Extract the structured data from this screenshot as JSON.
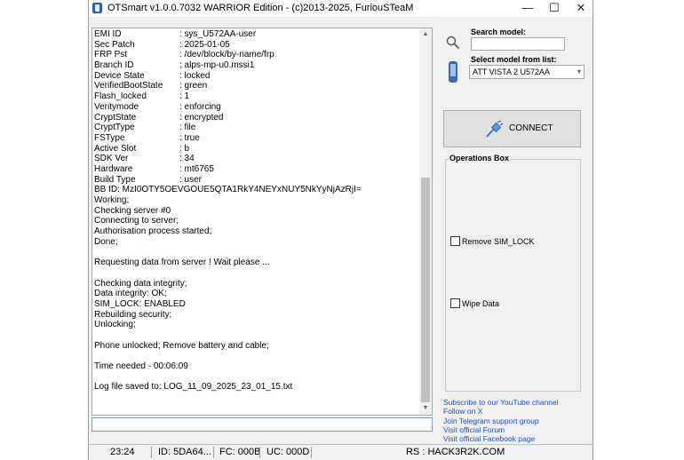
{
  "window": {
    "title": "OTSmart  v1.0.0.7032 WARRIOR Edition - (c)2013-2025, FuriouSTeaM",
    "minimize": "—",
    "maximize": "☐",
    "close": "✕"
  },
  "log": {
    "kv": [
      {
        "key": "EMI ID",
        "value": ": sys_U572AA-user"
      },
      {
        "key": "Sec Patch",
        "value": ": 2025-01-05"
      },
      {
        "key": "FRP Pst",
        "value": ": /dev/block/by-name/frp"
      },
      {
        "key": "Branch ID",
        "value": ": alps-mp-u0.mssi1"
      },
      {
        "key": "Device State",
        "value": ": locked"
      },
      {
        "key": "VerifiedBootState",
        "value": ": green"
      },
      {
        "key": "Flash_locked",
        "value": ": 1"
      },
      {
        "key": "Veritymode",
        "value": ": enforcing"
      },
      {
        "key": "CryptState",
        "value": ": encrypted"
      },
      {
        "key": "CryptType",
        "value": ": file"
      },
      {
        "key": "FSType",
        "value": ": true"
      },
      {
        "key": "Active Slot",
        "value": ": b"
      },
      {
        "key": "SDK Ver",
        "value": ": 34"
      },
      {
        "key": "Hardware",
        "value": ": mt6765"
      },
      {
        "key": "Build Type",
        "value": ": user"
      }
    ],
    "lines": [
      "BB ID: MzI0OTY5OEVGOUE5QTA1RkY4NEYxNUY5NkYyNjAzRjI=",
      "Working;",
      "Checking server #0",
      "Connecting to server;",
      "Authorisation process started;",
      "Done;",
      "",
      "Requesting data from server ! Wait please ...",
      "",
      "Checking data integrity;",
      "Data integrity: OK;",
      "SIM_LOCK: ENABLED",
      "Rebuilding security;",
      "Unlocking;",
      "",
      "Phone unlocked; Remove battery and cable;",
      "",
      "Time needed - 00:06:09",
      "",
      "Log file saved to: LOG_11_09_2025_23_01_15.txt"
    ],
    "command_value": ""
  },
  "search": {
    "label": "Search model:",
    "value": ""
  },
  "model": {
    "label": "Select model from list:",
    "selected": "ATT VISTA 2 U572AA"
  },
  "connect": {
    "label": "CONNECT"
  },
  "operations": {
    "title": "Operations Box",
    "remove_sim_lock": "Remove SIM_LOCK",
    "wipe_data": "Wipe Data"
  },
  "links": [
    "Subscribe to our YouTube channel",
    "Follow on X",
    "Join Telegram support group",
    "Visit official Forum",
    "Visit official Facebook page"
  ],
  "status": {
    "time": "23:24",
    "id": "ID: 5DA64...",
    "fc": "FC: 000B",
    "uc": "UC: 000D",
    "rs": "RS : HACK3R2K.COM"
  },
  "colors": {
    "link": "#1a4fcf",
    "accent": "#3e6bb0"
  }
}
